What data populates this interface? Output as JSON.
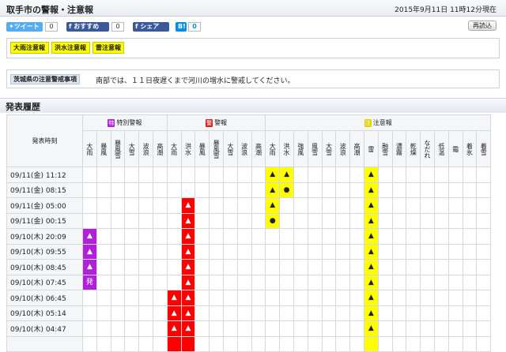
{
  "header": {
    "title": "取手市の警報・注意報",
    "timestamp": "2015年9月11日 11時12分現在"
  },
  "social": {
    "tweet_label": "ツイート",
    "tweet_count": "0",
    "recommend_label": "おすすめ",
    "recommend_count": "0",
    "share_label": "シェア",
    "share_count": "0",
    "hatena_label": "B!",
    "hatena_count": "0"
  },
  "print_label": "再読込",
  "current_advisories": [
    "大雨注意報",
    "洪水注意報",
    "雷注意報"
  ],
  "notice": {
    "label": "茨城県の注意警戒事項",
    "text": "南部では、１１日夜遅くまで河川の増水に警戒してください。"
  },
  "history_title": "発表履歴",
  "table": {
    "time_header": "発表時刻",
    "groups": [
      {
        "tag": "特",
        "label": "特別警報",
        "span": 6,
        "color": "#b020d8"
      },
      {
        "tag": "警",
        "label": "警報",
        "span": 7,
        "color": "#e02020"
      },
      {
        "tag": "注",
        "label": "注意報",
        "span": 16,
        "color": "#e8d000"
      }
    ],
    "columns": [
      "大雨",
      "暴風",
      "暴風雪",
      "大雪",
      "波浪",
      "高潮",
      "大雨",
      "洪水",
      "暴風",
      "暴風雪",
      "大雪",
      "波浪",
      "高潮",
      "大雨",
      "洪水",
      "強風",
      "風雪",
      "大雪",
      "波浪",
      "高潮",
      "雷",
      "融雪",
      "濃霧",
      "乾燥",
      "なだれ",
      "低温",
      "霜",
      "着氷",
      "着雪"
    ],
    "rows": [
      {
        "time": "09/11(金) 11:12",
        "cells": {
          "13": "▲",
          "14": "▲",
          "20": "▲"
        }
      },
      {
        "time": "09/11(金) 08:15",
        "cells": {
          "13": "▲",
          "14": "●",
          "20": "▲"
        }
      },
      {
        "time": "09/11(金) 05:00",
        "cells": {
          "7": "▲",
          "13": "▲",
          "20": "▲"
        }
      },
      {
        "time": "09/11(金) 00:15",
        "cells": {
          "7": "▲",
          "13": "●",
          "20": "▲"
        }
      },
      {
        "time": "09/10(木) 20:09",
        "cells": {
          "0": "▲",
          "7": "▲",
          "20": "▲"
        }
      },
      {
        "time": "09/10(木) 09:55",
        "cells": {
          "0": "▲",
          "7": "▲",
          "20": "▲"
        }
      },
      {
        "time": "09/10(木) 08:45",
        "cells": {
          "0": "▲",
          "7": "▲",
          "20": "▲"
        }
      },
      {
        "time": "09/10(木) 07:45",
        "cells": {
          "0": "発",
          "7": "▲",
          "20": "▲"
        }
      },
      {
        "time": "09/10(木) 06:45",
        "cells": {
          "6": "▲",
          "7": "▲",
          "20": "▲"
        }
      },
      {
        "time": "09/10(木) 05:14",
        "cells": {
          "6": "▲",
          "7": "▲",
          "20": "▲"
        }
      },
      {
        "time": "09/10(木) 04:47",
        "cells": {
          "6": "▲",
          "7": "▲",
          "20": "▲"
        }
      },
      {
        "time": "",
        "cells": {
          "6": "",
          "7": "",
          "20": ""
        }
      }
    ]
  },
  "colors": {
    "advisory": "#ffff00",
    "warning": "#ff0000",
    "special": "#b020d8"
  }
}
